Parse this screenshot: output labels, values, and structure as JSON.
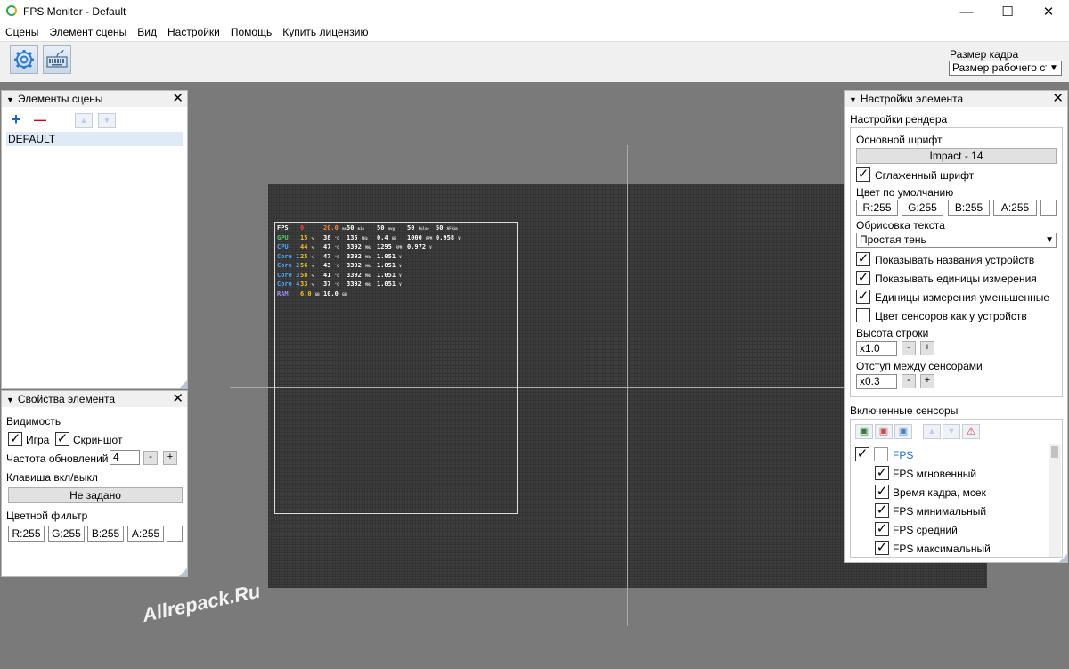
{
  "window": {
    "title": "FPS Monitor - Default",
    "minimize": "—",
    "maximize": "☐",
    "close": "✕"
  },
  "menu": [
    "Сцены",
    "Элемент сцены",
    "Вид",
    "Настройки",
    "Помощь",
    "Купить лицензию"
  ],
  "toolbar": {
    "settings_icon": "gear-icon",
    "keyboard_icon": "keyboard-icon",
    "frame_label": "Размер кадра",
    "frame_value": "Размер рабочего стола"
  },
  "scene_panel": {
    "title": "Элементы сцены",
    "add": "+",
    "remove": "—",
    "up": "▲",
    "down": "▼",
    "items": [
      "DEFAULT"
    ]
  },
  "props_panel": {
    "title": "Свойства элемента",
    "visibility_label": "Видимость",
    "game_label": "Игра",
    "screenshot_label": "Скриншот",
    "refresh_label": "Частота обновлений",
    "refresh_value": "4",
    "minus": "-",
    "plus": "+",
    "hotkey_label": "Клавиша вкл/выкл",
    "hotkey_value": "Не задано",
    "filter_label": "Цветной фильтр",
    "r": "R:255",
    "g": "G:255",
    "b": "B:255",
    "a": "A:255"
  },
  "settings_panel": {
    "title": "Настройки элемента",
    "render_header": "Настройки рендера",
    "font_label": "Основной шрифт",
    "font_value": "Impact - 14",
    "smooth_label": "Сглаженный шрифт",
    "default_color_label": "Цвет по умолчанию",
    "r": "R:255",
    "g": "G:255",
    "b": "B:255",
    "a": "A:255",
    "outline_label": "Обрисовка текста",
    "outline_value": "Простая тень",
    "show_names_label": "Показывать названия устройств",
    "show_units_label": "Показывать единицы измерения",
    "small_units_label": "Единицы измерения уменьшенные",
    "sensor_color_label": "Цвет сенсоров как у устройств",
    "row_height_label": "Высота строки",
    "row_height_value": "x1.0",
    "spacing_label": "Отступ между сенсорами",
    "spacing_value": "x0.3",
    "minus": "-",
    "plus": "+",
    "sensors_header": "Включенные сенсоры",
    "sensor_group": "FPS",
    "sensors": [
      "FPS мгновенный",
      "Время кадра, мсек",
      "FPS минимальный",
      "FPS средний",
      "FPS максимальный"
    ]
  },
  "osd": [
    {
      "label": "FPS",
      "color": "#ffffff",
      "cells": [
        "0",
        "20.0",
        "50",
        "50",
        "50",
        "50"
      ],
      "units": [
        "",
        "ms",
        "min",
        "avg",
        "Pulse",
        "AFsim"
      ]
    },
    {
      "label": "GPU",
      "color": "#49d36a",
      "cells": [
        "15",
        "38",
        "135",
        "0.4",
        "1000",
        "0.958"
      ],
      "units": [
        "%",
        "°C",
        "MHz",
        "GB",
        "RPM",
        "V"
      ]
    },
    {
      "label": "CPU",
      "color": "#4da8ff",
      "cells": [
        "44",
        "47",
        "3392",
        "1295",
        "0.972"
      ],
      "units": [
        "%",
        "°C",
        "MHz",
        "RPM",
        "V"
      ]
    },
    {
      "label": "Core 1",
      "color": "#4da8ff",
      "cells": [
        "25",
        "47",
        "3392",
        "1.051"
      ],
      "units": [
        "%",
        "°C",
        "MHz",
        "V"
      ]
    },
    {
      "label": "Core 2",
      "color": "#4da8ff",
      "cells": [
        "56",
        "43",
        "3392",
        "1.051"
      ],
      "units": [
        "%",
        "°C",
        "MHz",
        "V"
      ]
    },
    {
      "label": "Core 3",
      "color": "#4da8ff",
      "cells": [
        "58",
        "41",
        "3392",
        "1.051"
      ],
      "units": [
        "%",
        "°C",
        "MHz",
        "V"
      ]
    },
    {
      "label": "Core 4",
      "color": "#4da8ff",
      "cells": [
        "33",
        "37",
        "3392",
        "1.051"
      ],
      "units": [
        "%",
        "°C",
        "MHz",
        "V"
      ]
    },
    {
      "label": "RAM",
      "color": "#9b8cff",
      "cells": [
        "6.0",
        "10.0"
      ],
      "units": [
        "GB",
        "GB"
      ]
    }
  ],
  "watermark": "Allrepack.Ru"
}
